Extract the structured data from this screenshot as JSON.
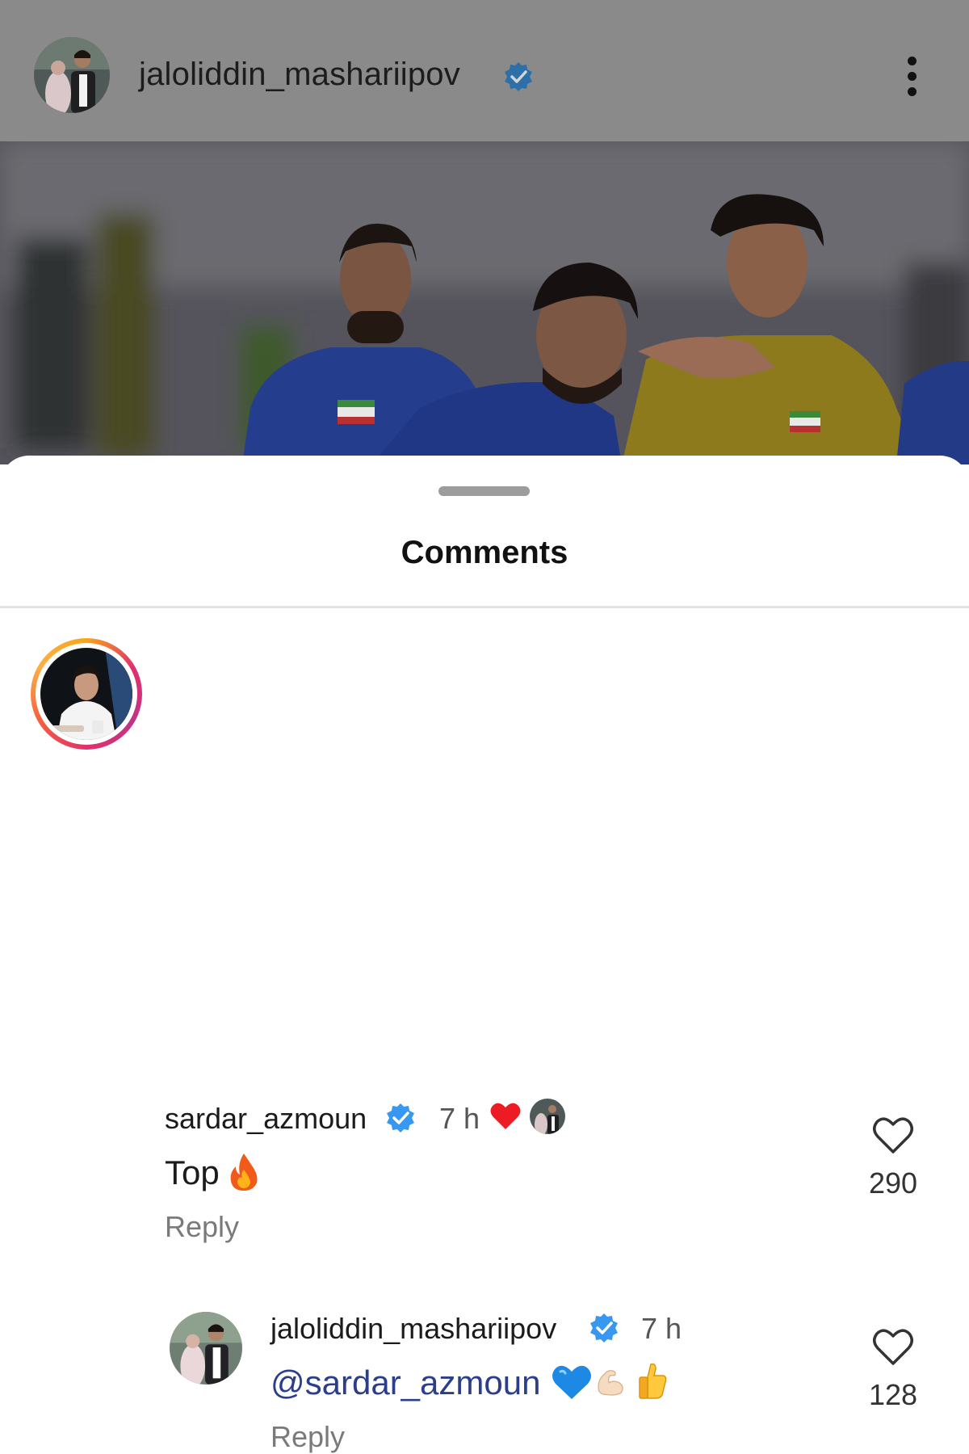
{
  "post": {
    "username": "jaloliddin_mashariipov",
    "verified": true
  },
  "sheet": {
    "title": "Comments"
  },
  "comments": [
    {
      "username": "sardar_azmoun",
      "verified": true,
      "time": "7 h",
      "liked_by_author": true,
      "text": "Top",
      "emoji": [
        "fire-emoji"
      ],
      "reply_label": "Reply",
      "likes": "290"
    },
    {
      "username": "jaloliddin_mashariipov",
      "verified": true,
      "time": "7 h",
      "mention": "@sardar_azmoun",
      "emoji": [
        "blue-heart-emoji",
        "flexed-biceps-emoji",
        "thumbs-up-emoji"
      ],
      "reply_label": "Reply",
      "likes": "128"
    }
  ],
  "colors": {
    "verified_badge": "#3897f0",
    "liked_heart": "#ed1c24",
    "mention": "#2a3e8c",
    "header_overlay": "#8a8a8a"
  }
}
